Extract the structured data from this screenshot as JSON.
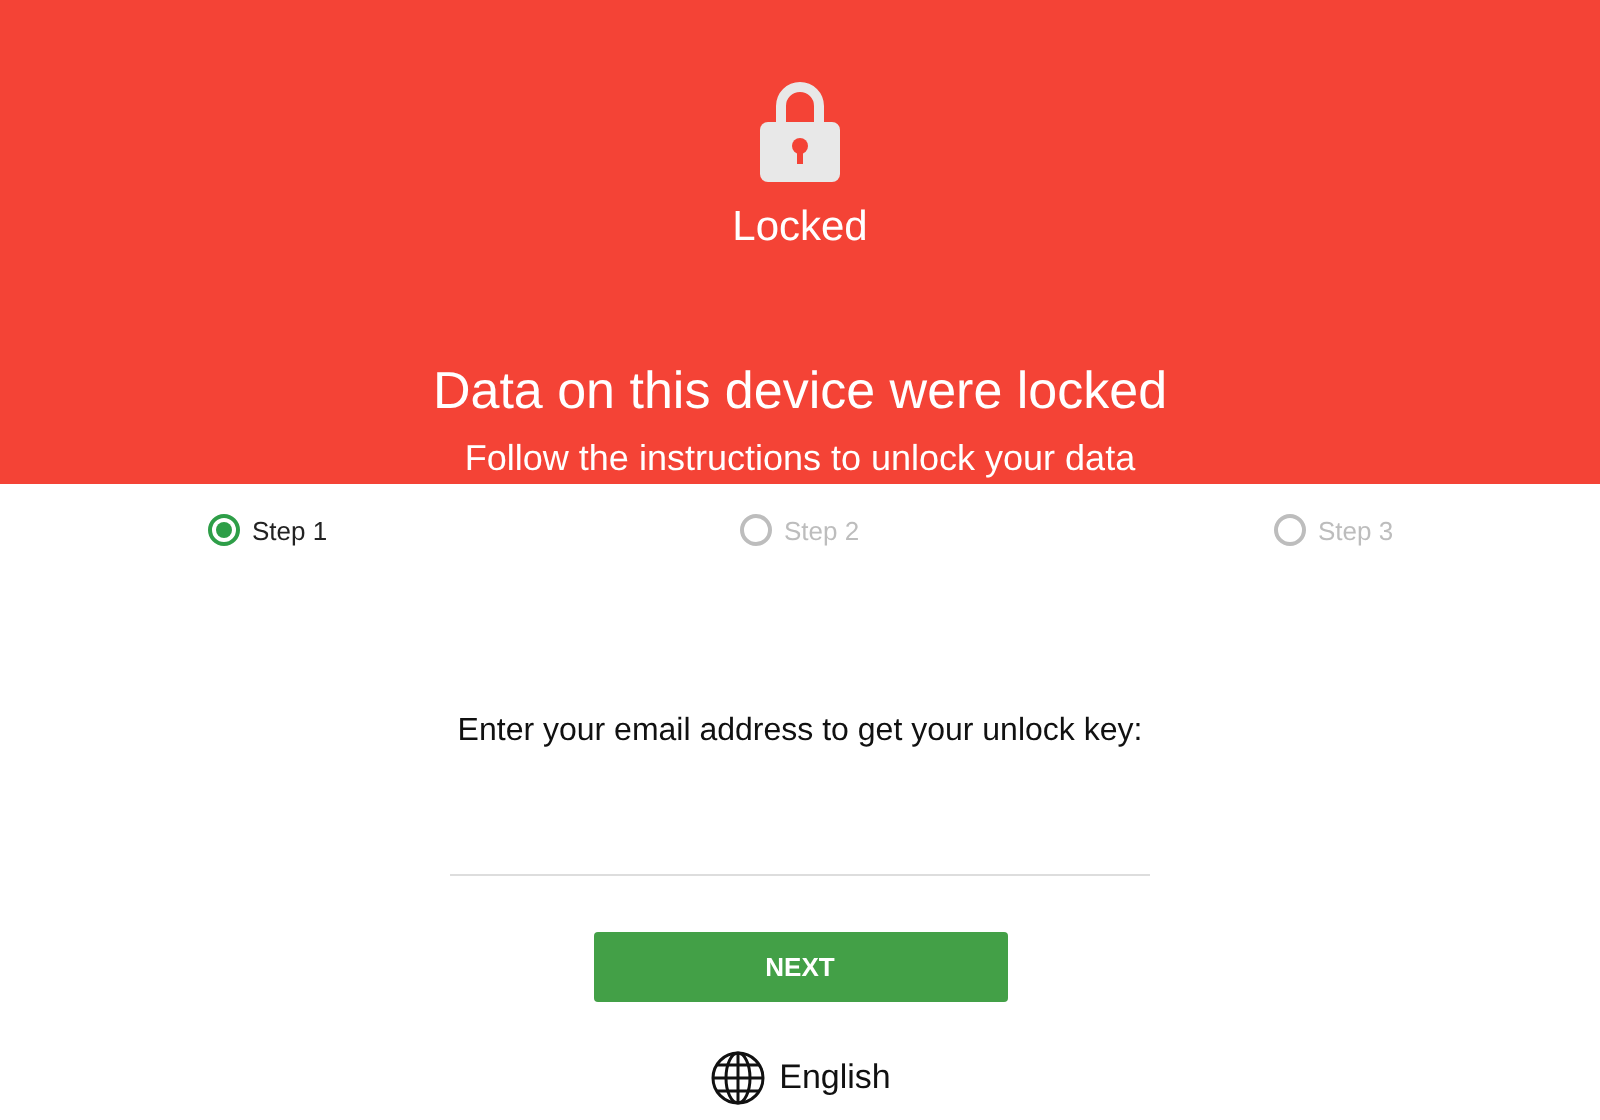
{
  "header": {
    "status": "Locked",
    "title": "Data on this device were locked",
    "subtitle": "Follow the instructions to unlock your data"
  },
  "steps": [
    {
      "label": "Step 1",
      "selected": true
    },
    {
      "label": "Step 2",
      "selected": false
    },
    {
      "label": "Step 3",
      "selected": false
    }
  ],
  "form": {
    "prompt": "Enter your email address to get your unlock key:",
    "button": "NEXT"
  },
  "language": "English"
}
